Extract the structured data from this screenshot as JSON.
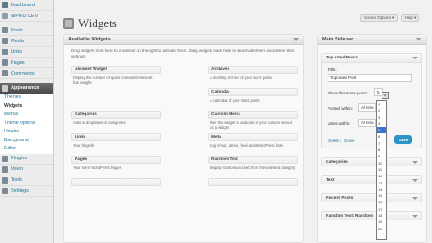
{
  "admin_menu": {
    "items": [
      {
        "label": "Dashboard",
        "icon": "dashboard-icon",
        "color": "#5a7a8c"
      },
      {
        "label": "WPMU DEV",
        "icon": "wpmudev-icon",
        "color": "#8aa0b0"
      },
      {
        "label": "Posts",
        "icon": "pin-icon",
        "color": "#7a8a99"
      },
      {
        "label": "Media",
        "icon": "media-icon",
        "color": "#7a8a99"
      },
      {
        "label": "Links",
        "icon": "links-icon",
        "color": "#7a8a99"
      },
      {
        "label": "Pages",
        "icon": "pages-icon",
        "color": "#7a8a99"
      },
      {
        "label": "Comments",
        "icon": "comments-icon",
        "color": "#7a8a99"
      }
    ],
    "appearance": {
      "label": "Appearance",
      "icon": "appearance-icon"
    },
    "appearance_sub": [
      "Themes",
      "Widgets",
      "Menus",
      "Theme Options",
      "Header",
      "Background",
      "Editor"
    ],
    "bottom_items": [
      {
        "label": "Plugins",
        "icon": "plugins-icon"
      },
      {
        "label": "Users",
        "icon": "users-icon"
      },
      {
        "label": "Tools",
        "icon": "tools-icon"
      },
      {
        "label": "Settings",
        "icon": "settings-icon"
      }
    ]
  },
  "top_buttons": {
    "screen_options": "Screen Options ▾",
    "help": "Help ▾"
  },
  "page_title": "Widgets",
  "available": {
    "heading": "Available Widgets",
    "description": "Drag widgets from here to a sidebar on the right to activate them. Drag widgets back here to deactivate them and delete their settings.",
    "widgets": [
      {
        "title": "Akismet Widget",
        "desc": "Display the number of spam comments Akismet has caught"
      },
      {
        "title": "Archives",
        "desc": "A monthly archive of your site's posts"
      },
      {
        "title": "",
        "desc": ""
      },
      {
        "title": "Calendar",
        "desc": "A calendar of your site's posts"
      },
      {
        "title": "Categories",
        "desc": "A list or dropdown of categories"
      },
      {
        "title": "Custom Menu",
        "desc": "Use this widget to add one of your custom menus as a widget."
      },
      {
        "title": "Links",
        "desc": "Your blogroll"
      },
      {
        "title": "Meta",
        "desc": "Log in/out, admin, feed and WordPress links"
      },
      {
        "title": "Pages",
        "desc": "Your site's WordPress Pages"
      },
      {
        "title": "Random Text",
        "desc": "Display randomized text from the selected category"
      }
    ]
  },
  "main_sidebar": {
    "heading": "Main Sidebar",
    "open_widget": {
      "title": "Top rated Posts",
      "title_label": "Title:",
      "title_value": "Top rated Post",
      "count_label": "Show this many posts:",
      "count_value": "5",
      "posted_within_label": "Posted within:",
      "posted_within_value": "All time",
      "voted_within_label": "Voted within:",
      "voted_within_value": "All time",
      "delete": "Delete",
      "close": "Close",
      "save": "Save"
    },
    "collapsed": [
      "Categories",
      "Text",
      "Recent Posts",
      "Random Text: Random"
    ],
    "dropdown_options": [
      "1",
      "2",
      "3",
      "4",
      "5",
      "6",
      "7",
      "8",
      "9",
      "10",
      "11",
      "12",
      "13",
      "14",
      "15",
      "16",
      "17",
      "18",
      "19",
      "20"
    ],
    "dropdown_selected": "5"
  }
}
